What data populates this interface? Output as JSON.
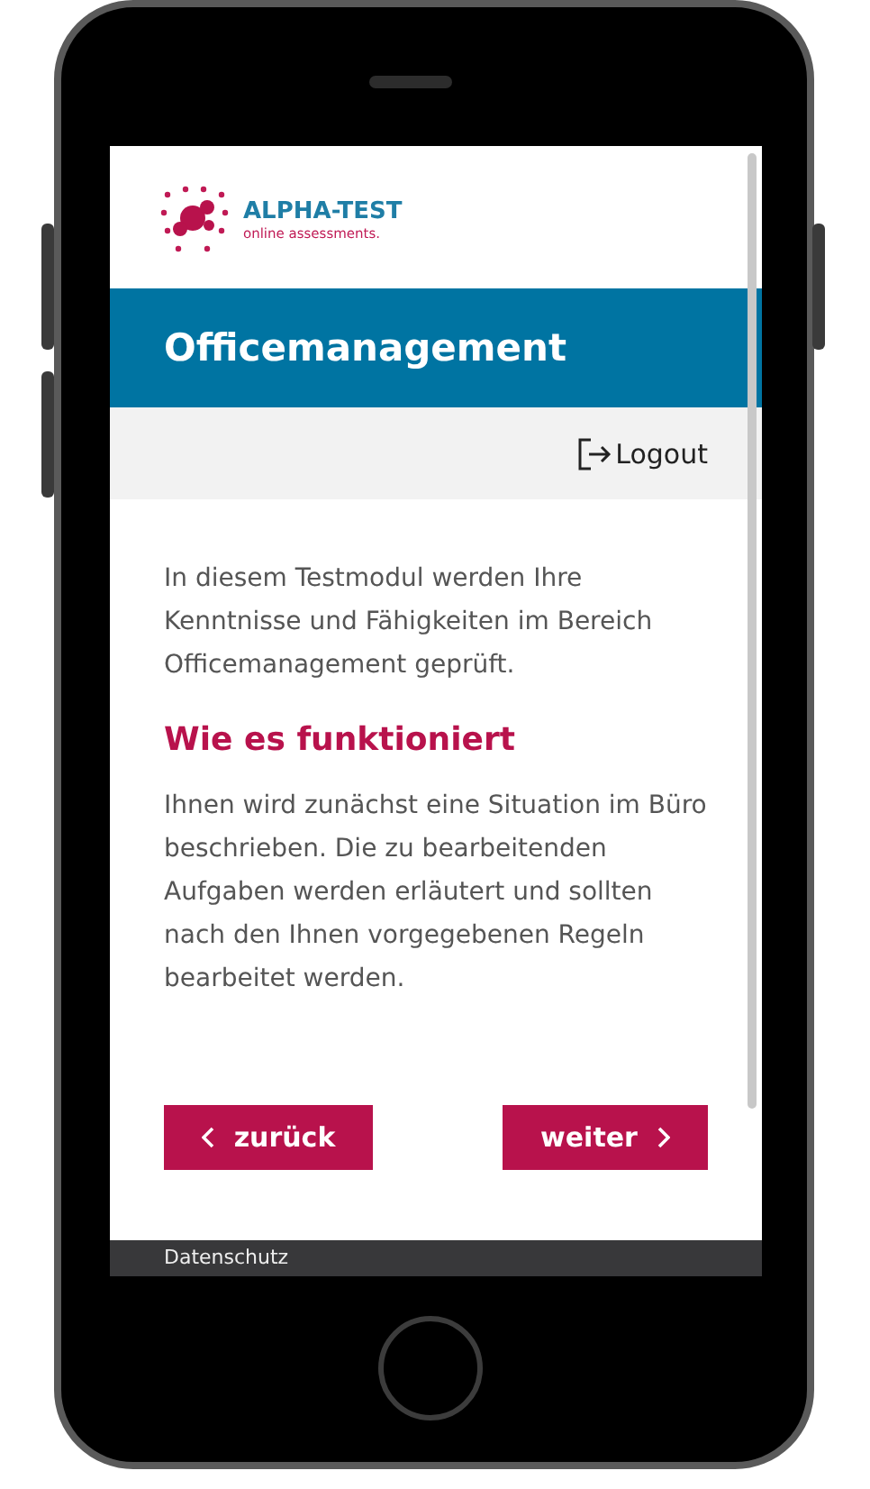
{
  "logo": {
    "name": "ALPHA-TEST",
    "tagline": "online assessments."
  },
  "header": {
    "title": "Officemanagement"
  },
  "toolbar": {
    "logout": "Logout"
  },
  "content": {
    "intro": "In diesem Testmodul werden Ihre Kenntnisse und Fähigkeiten im Bereich Officemanagement geprüft.",
    "heading": "Wie es funktioniert",
    "body": "Ihnen wird zunächst eine Situation im Büro beschrieben. Die zu bearbeitenden Aufgaben werden erläutert und sollten nach den Ihnen vorgegebenen Regeln bearbeitet werden."
  },
  "buttons": [
    {
      "label": "zurück",
      "kind": "back"
    },
    {
      "label": "weiter",
      "kind": "next"
    }
  ],
  "footer": {
    "link": "Datenschutz"
  }
}
